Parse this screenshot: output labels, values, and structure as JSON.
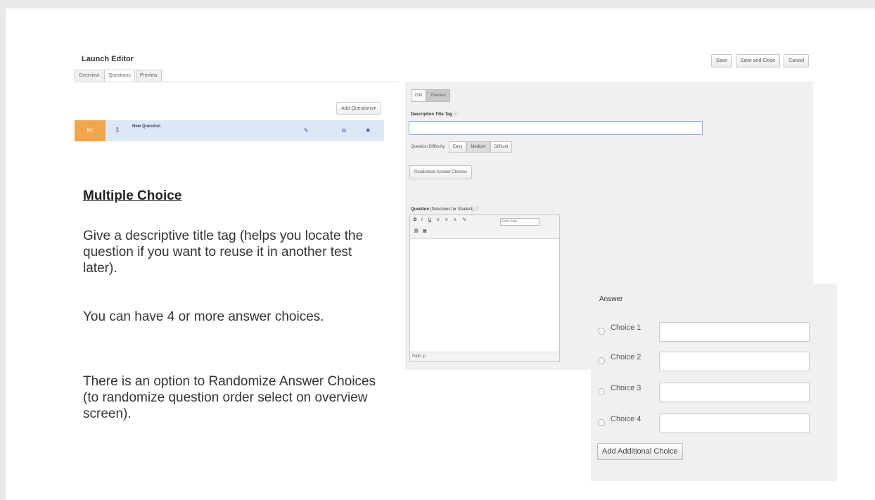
{
  "editor": {
    "title": "Launch Editor",
    "tabs": [
      "Overview",
      "Questions",
      "Preview"
    ],
    "buttons": {
      "save": "Save",
      "save_close": "Save and Close",
      "cancel": "Cancel"
    }
  },
  "question_list": {
    "add_questions": "Add Questions▾",
    "row": {
      "type": "MC",
      "number": "1",
      "title": "New Question"
    }
  },
  "instructions": {
    "heading": "Multiple Choice",
    "paragraphs": [
      "Give a descriptive title tag (helps you locate the question if you want to reuse it in another test later).",
      "You can have 4 or more answer choices.",
      "There is an option to Randomize Answer Choices  (to randomize question order select on overview screen)."
    ]
  },
  "question_editor": {
    "tabs": [
      "Edit",
      "Preview"
    ],
    "desc_title_label": "Description Title Tag",
    "difficulty_label": "Question Difficulty",
    "difficulty_options": [
      "Easy",
      "Medium",
      "Difficult"
    ],
    "randomize_label": "Randomize Answer Choices",
    "question_label_bold": "Question",
    "question_label_rest": " (Directions for Student)",
    "font_size_select": "Font Size",
    "path_label": "Path: p"
  },
  "answer": {
    "title": "Answer",
    "choices": [
      "Choice 1",
      "Choice 2",
      "Choice 3",
      "Choice 4"
    ],
    "add_choice": "Add Additional Choice"
  }
}
